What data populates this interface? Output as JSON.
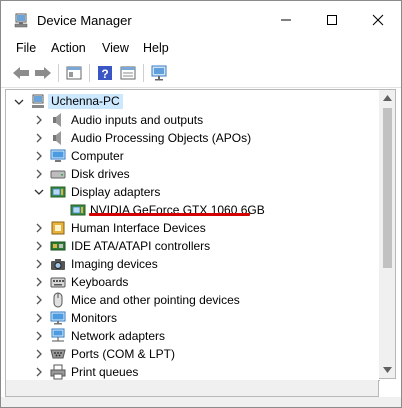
{
  "window": {
    "title": "Device Manager"
  },
  "menu": [
    "File",
    "Action",
    "View",
    "Help"
  ],
  "tree": {
    "root": "Uchenna-PC",
    "items": [
      {
        "label": "Audio inputs and outputs",
        "icon": "speaker-icon",
        "expanded": false
      },
      {
        "label": "Audio Processing Objects (APOs)",
        "icon": "speaker-icon",
        "expanded": false
      },
      {
        "label": "Computer",
        "icon": "computer-icon",
        "expanded": false
      },
      {
        "label": "Disk drives",
        "icon": "disk-drive-icon",
        "expanded": false
      },
      {
        "label": "Display adapters",
        "icon": "display-adapter-icon",
        "expanded": true
      },
      {
        "label": "NVIDIA GeForce GTX 1060 6GB",
        "icon": "display-adapter-icon",
        "child": true
      },
      {
        "label": "Human Interface Devices",
        "icon": "hid-icon",
        "expanded": false
      },
      {
        "label": "IDE ATA/ATAPI controllers",
        "icon": "ide-controller-icon",
        "expanded": false
      },
      {
        "label": "Imaging devices",
        "icon": "camera-icon",
        "expanded": false
      },
      {
        "label": "Keyboards",
        "icon": "keyboard-icon",
        "expanded": false
      },
      {
        "label": "Mice and other pointing devices",
        "icon": "mouse-icon",
        "expanded": false
      },
      {
        "label": "Monitors",
        "icon": "monitor-icon",
        "expanded": false
      },
      {
        "label": "Network adapters",
        "icon": "network-icon",
        "expanded": false
      },
      {
        "label": "Ports (COM & LPT)",
        "icon": "port-icon",
        "expanded": false
      },
      {
        "label": "Print queues",
        "icon": "printer-icon",
        "expanded": false
      }
    ]
  },
  "colors": {
    "highlight_underline": "#d40000",
    "root_selection": "#cce8ff"
  }
}
